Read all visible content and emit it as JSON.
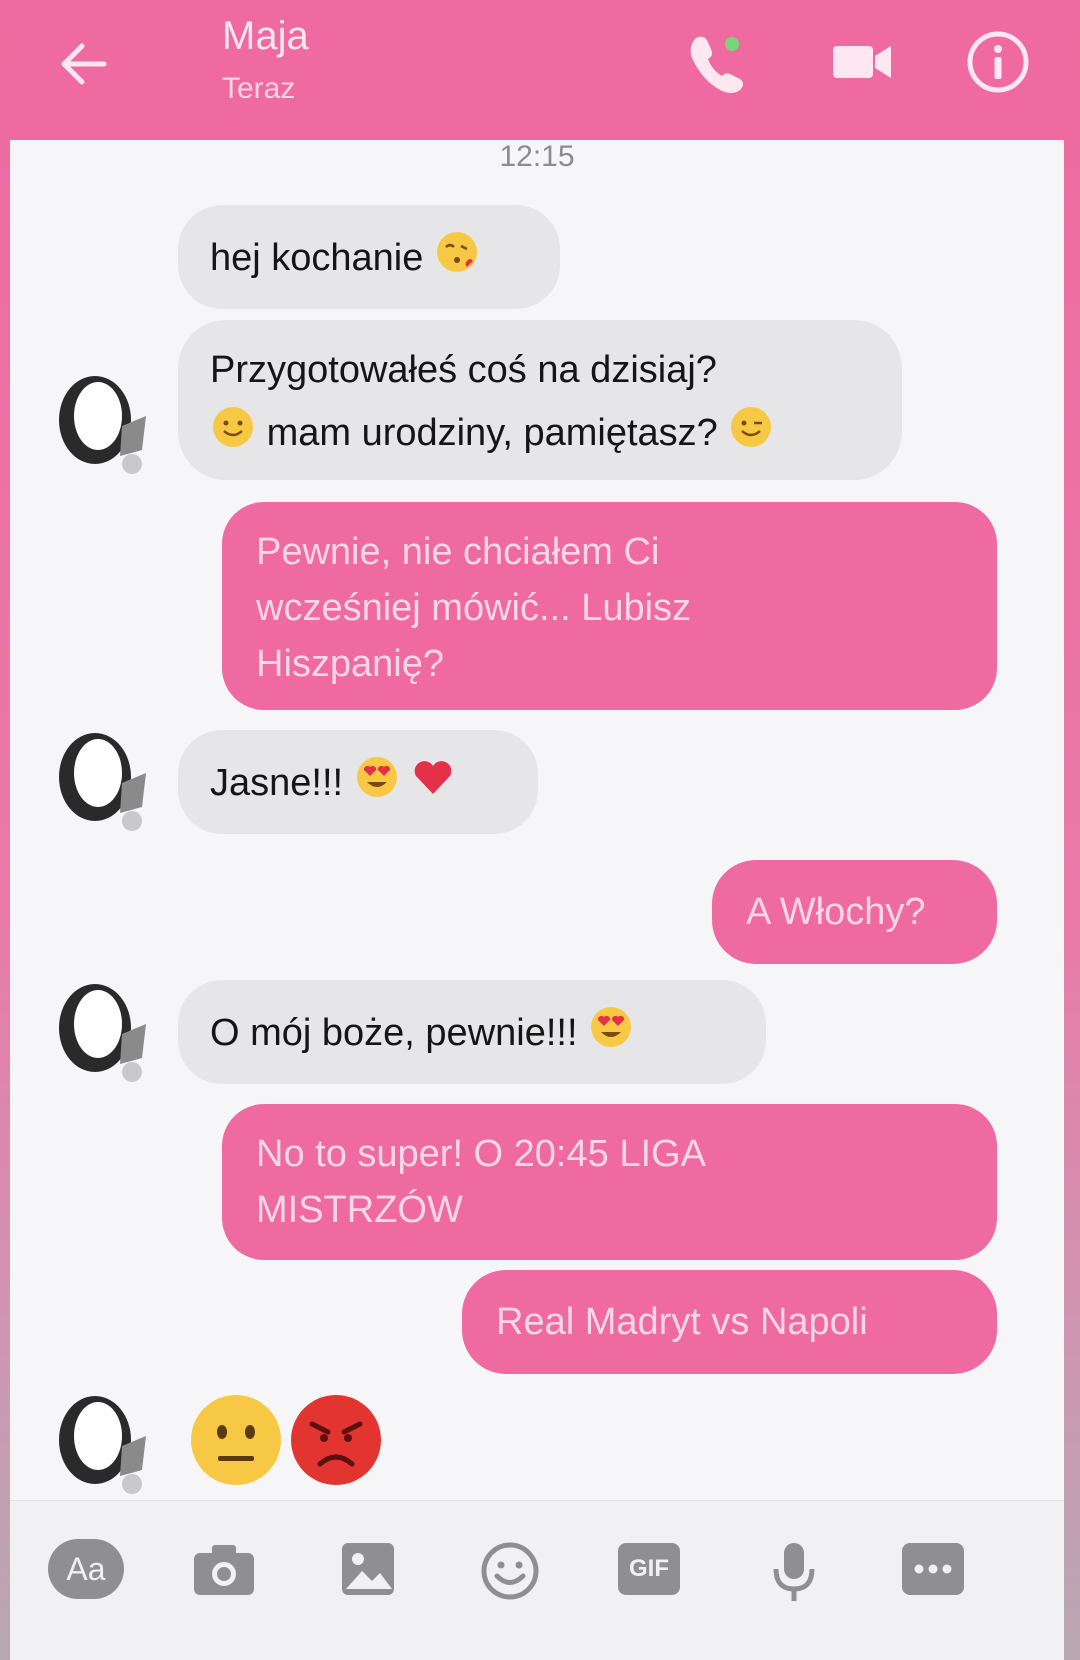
{
  "header": {
    "contact_name": "Maja",
    "status": "Teraz",
    "icons": [
      "back-arrow-icon",
      "phone-call-icon",
      "video-camera-icon",
      "info-icon"
    ],
    "color": "#ef6aa0"
  },
  "conversation": {
    "timestamp": "12:15",
    "messages": [
      {
        "from": "Maja",
        "text": "hej kochanie",
        "emoji": [
          "kissing-face"
        ]
      },
      {
        "from": "Maja",
        "lines": [
          "Przygotowałeś coś na dzisiaj?",
          "mam urodziny, pamiętasz?"
        ],
        "emoji": [
          "slightly-smiling-face",
          "winking-face"
        ]
      },
      {
        "from": "me",
        "lines": [
          "Pewnie, nie chciałem Ci",
          "wcześniej mówić... Lubisz",
          "Hiszpanię?"
        ]
      },
      {
        "from": "Maja",
        "text": "Jasne!!!",
        "emoji": [
          "heart-eyes-face",
          "red-heart"
        ]
      },
      {
        "from": "me",
        "text": "A Włochy?"
      },
      {
        "from": "Maja",
        "text": "O mój boże, pewnie!!!",
        "emoji": [
          "heart-eyes-face"
        ]
      },
      {
        "from": "me",
        "lines": [
          "No to super! O 20:45 LIGA",
          "MISTRZÓW"
        ]
      },
      {
        "from": "me",
        "text": "Real Madryt vs Napoli"
      },
      {
        "from": "Maja",
        "emoji": [
          "neutral-face",
          "angry-face"
        ]
      }
    ]
  },
  "composer": {
    "aa_label": "Aa",
    "gif_label": "GIF",
    "icons": [
      "text-format-icon",
      "camera-icon",
      "image-icon",
      "emoji-icon",
      "gif-icon",
      "microphone-icon",
      "more-icon"
    ]
  }
}
